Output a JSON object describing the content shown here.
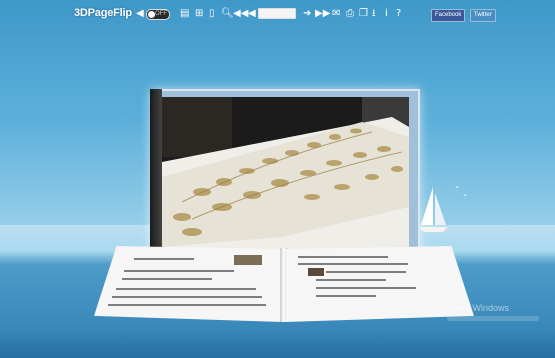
{
  "toolbar": {
    "logo": "3DPageFlip",
    "sound_toggle_label": "OFF",
    "page_input_value": "",
    "icons": [
      "volume-icon",
      "thumbnails-icon",
      "grid-icon",
      "single-page-icon",
      "zoom-icon",
      "first-page-icon",
      "previous-page-icon",
      "next-page-icon",
      "last-page-icon",
      "email-icon",
      "print-icon",
      "fullscreen-icon",
      "download-icon",
      "info-icon",
      "help-icon"
    ],
    "help_glyph": "?",
    "info_glyph": "i",
    "facebook_label": "Facebook",
    "twitter_label": "Twitter"
  },
  "watermark": {
    "title": "Activate Windows"
  },
  "colors": {
    "sky_top": "#3f98c9",
    "horizon": "#a7d8ef",
    "sea": "#2f7fb3",
    "facebook": "#3b5998",
    "twitter": "#4a8fc4"
  }
}
